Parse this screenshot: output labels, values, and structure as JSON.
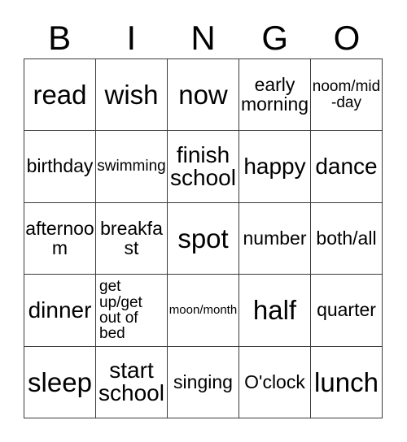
{
  "card": {
    "title_letters": [
      "B",
      "I",
      "N",
      "G",
      "O"
    ],
    "columns": 5,
    "rows": 5,
    "border_color": "#3a3a3a",
    "background_color": "#ffffff",
    "text_color": "#000000",
    "cells": [
      [
        {
          "text": "read",
          "size": "fs-xl",
          "align": "center"
        },
        {
          "text": "wish",
          "size": "fs-xl",
          "align": "center"
        },
        {
          "text": "now",
          "size": "fs-xl",
          "align": "center"
        },
        {
          "text": "early morning",
          "size": "fs-md",
          "align": "center"
        },
        {
          "text": "noom/mid-day",
          "size": "fs-sm",
          "align": "center"
        }
      ],
      [
        {
          "text": "birthday",
          "size": "fs-md",
          "align": "center"
        },
        {
          "text": "swimming",
          "size": "fs-sm",
          "align": "center"
        },
        {
          "text": "finish school",
          "size": "fs-lg",
          "align": "center"
        },
        {
          "text": "happy",
          "size": "fs-lg",
          "align": "center"
        },
        {
          "text": "dance",
          "size": "fs-lg",
          "align": "center"
        }
      ],
      [
        {
          "text": "afternoom",
          "size": "fs-md",
          "align": "center"
        },
        {
          "text": "breakfast",
          "size": "fs-md",
          "align": "center"
        },
        {
          "text": "spot",
          "size": "fs-xl",
          "align": "center"
        },
        {
          "text": "number",
          "size": "fs-md",
          "align": "center"
        },
        {
          "text": "both/all",
          "size": "fs-md",
          "align": "center"
        }
      ],
      [
        {
          "text": "dinner",
          "size": "fs-lg",
          "align": "center"
        },
        {
          "text": "get up/get out of bed",
          "size": "fs-sm",
          "align": "left"
        },
        {
          "text": "moon/month",
          "size": "fs-xs",
          "align": "center"
        },
        {
          "text": "half",
          "size": "fs-xl",
          "align": "center"
        },
        {
          "text": "quarter",
          "size": "fs-md",
          "align": "center"
        }
      ],
      [
        {
          "text": "sleep",
          "size": "fs-xl",
          "align": "center"
        },
        {
          "text": "start school",
          "size": "fs-lg",
          "align": "center"
        },
        {
          "text": "singing",
          "size": "fs-md",
          "align": "center"
        },
        {
          "text": "O'clock",
          "size": "fs-md",
          "align": "center"
        },
        {
          "text": "lunch",
          "size": "fs-xl",
          "align": "center"
        }
      ]
    ]
  }
}
